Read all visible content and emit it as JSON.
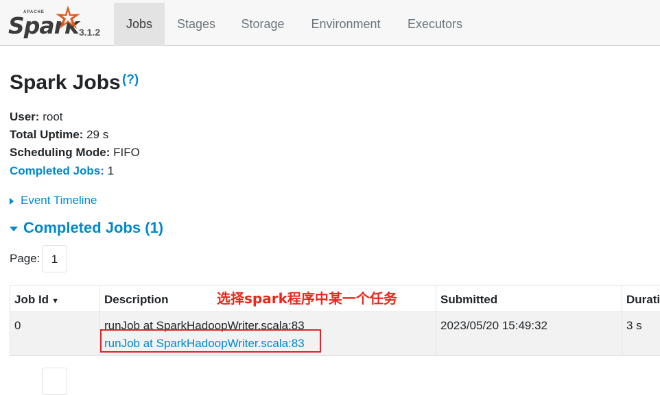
{
  "navbar": {
    "brand": {
      "apache": "APACHE",
      "logo": "Spark",
      "version": "3.1.2"
    },
    "tabs": [
      {
        "label": "Jobs",
        "active": true
      },
      {
        "label": "Stages",
        "active": false
      },
      {
        "label": "Storage",
        "active": false
      },
      {
        "label": "Environment",
        "active": false
      },
      {
        "label": "Executors",
        "active": false
      }
    ]
  },
  "page": {
    "title": "Spark Jobs",
    "help": "(?)",
    "user_label": "User:",
    "user_value": "root",
    "uptime_label": "Total Uptime:",
    "uptime_value": "29 s",
    "mode_label": "Scheduling Mode:",
    "mode_value": "FIFO",
    "completed_label": "Completed Jobs:",
    "completed_value": "1",
    "event_timeline": "Event Timeline",
    "section_title": "Completed Jobs (1)",
    "page_label": "Page:",
    "page_number": "1"
  },
  "table": {
    "headers": {
      "job_id": "Job Id",
      "sort_arrow": "▼",
      "description": "Description",
      "submitted": "Submitted",
      "duration": "Duration"
    },
    "rows": [
      {
        "job_id": "0",
        "desc_sub": "runJob at SparkHadoopWriter.scala:83",
        "desc_link": "runJob at SparkHadoopWriter.scala:83",
        "submitted": "2023/05/20 15:49:32",
        "duration": "3 s"
      }
    ]
  },
  "annotation": {
    "text": "选择spark程序中某一个任务",
    "color": "#e8281c"
  },
  "colors": {
    "link": "#0088cc",
    "navbar_bg": "#f7f7f7",
    "active_tab_bg": "#e3e3e3",
    "highlight": "#d9262a"
  }
}
